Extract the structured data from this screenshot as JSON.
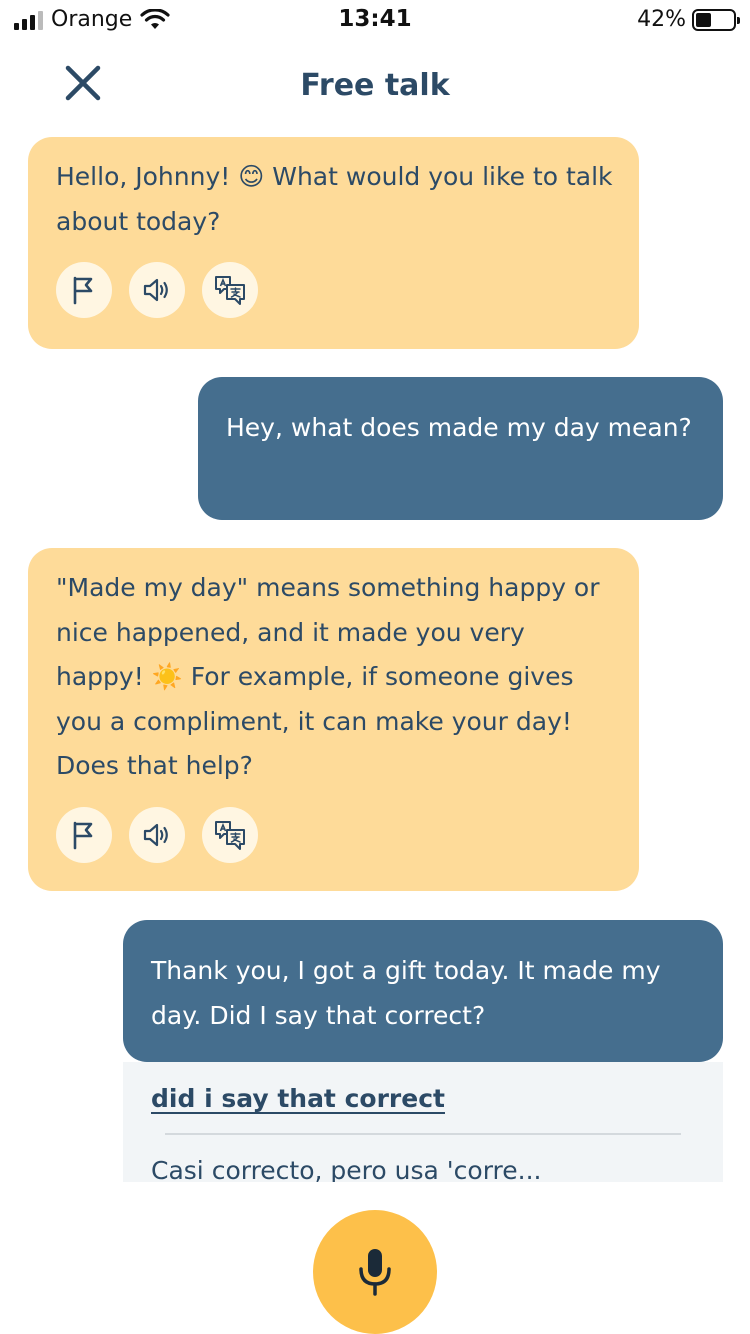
{
  "status_bar": {
    "carrier": "Orange",
    "time": "13:41",
    "battery_percent": "42%",
    "battery_level": 0.42,
    "signal_bars": 3,
    "icons": [
      "cellular-signal-icon",
      "wifi-icon",
      "battery-icon"
    ]
  },
  "header": {
    "title": "Free talk",
    "close_icon": "close-icon"
  },
  "messages": [
    {
      "sender": "bot",
      "text": "Hello, Johnny! 😊  What would you like to talk about today?",
      "actions": [
        "flag-icon",
        "speaker-icon",
        "translate-icon"
      ]
    },
    {
      "sender": "user",
      "text": "Hey, what does made my day mean?"
    },
    {
      "sender": "bot",
      "text": "\"Made my day\" means something happy or nice happened, and it made you very happy! ☀️  For example, if someone gives you a compliment, it can make your day! Does that help?",
      "actions": [
        "flag-icon",
        "speaker-icon",
        "translate-icon"
      ]
    },
    {
      "sender": "user",
      "text": "Thank you, I got a gift today. It made my day. Did I say that correct?"
    }
  ],
  "feedback": {
    "link_text": "did i say that correct",
    "preview_text": "Casi correcto, pero usa 'corre..."
  },
  "mic_button": {
    "icon": "microphone-icon"
  },
  "colors": {
    "bot_bubble": "#fedb99",
    "user_bubble": "#456e8e",
    "text_dark": "#2c4a66",
    "mic_button": "#fdc04a",
    "action_button": "#fff6e2",
    "feedback_bg": "#f2f5f7"
  }
}
